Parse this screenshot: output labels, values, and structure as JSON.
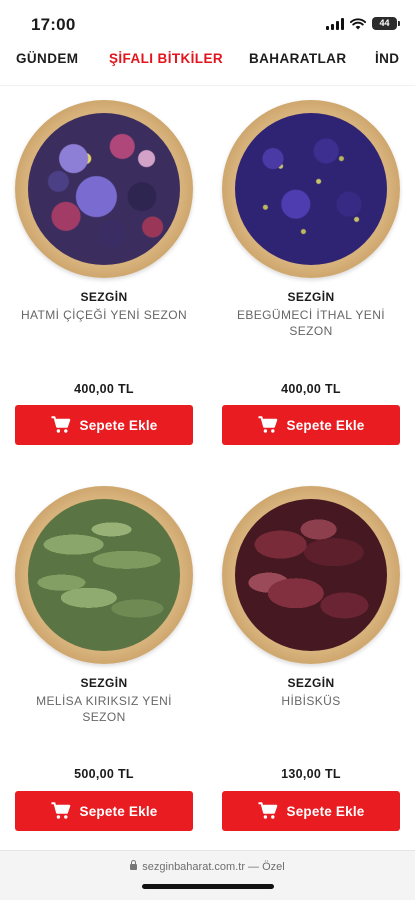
{
  "status_bar": {
    "time": "17:00",
    "battery": "44"
  },
  "category_nav": {
    "items": [
      {
        "label": "GÜNDEM"
      },
      {
        "label": "ŞİFALI BİTKİLER",
        "active": true
      },
      {
        "label": "BAHARATLAR"
      },
      {
        "label": "İND"
      }
    ]
  },
  "products": [
    {
      "brand": "SEZGİN",
      "name": "HATMİ ÇİÇEĞİ YENİ SEZON",
      "price": "400,00 TL",
      "button": "Sepete Ekle",
      "image_icon": "marshmallow-flower-plate-image"
    },
    {
      "brand": "SEZGİN",
      "name": "EBEGÜMECİ İTHAL YENİ SEZON",
      "price": "400,00 TL",
      "button": "Sepete Ekle",
      "image_icon": "mallow-plate-image"
    },
    {
      "brand": "SEZGİN",
      "name": "MELİSA KIRIKSIZ YENİ SEZON",
      "price": "500,00 TL",
      "button": "Sepete Ekle",
      "image_icon": "lemon-balm-plate-image"
    },
    {
      "brand": "SEZGİN",
      "name": "HİBİSKÜS",
      "price": "130,00 TL",
      "button": "Sepete Ekle",
      "image_icon": "hibiscus-plate-image"
    }
  ],
  "browser": {
    "url": "sezginbaharat.com.tr — Özel"
  },
  "colors": {
    "accent": "#e81c21",
    "active_nav": "#e3141b"
  }
}
